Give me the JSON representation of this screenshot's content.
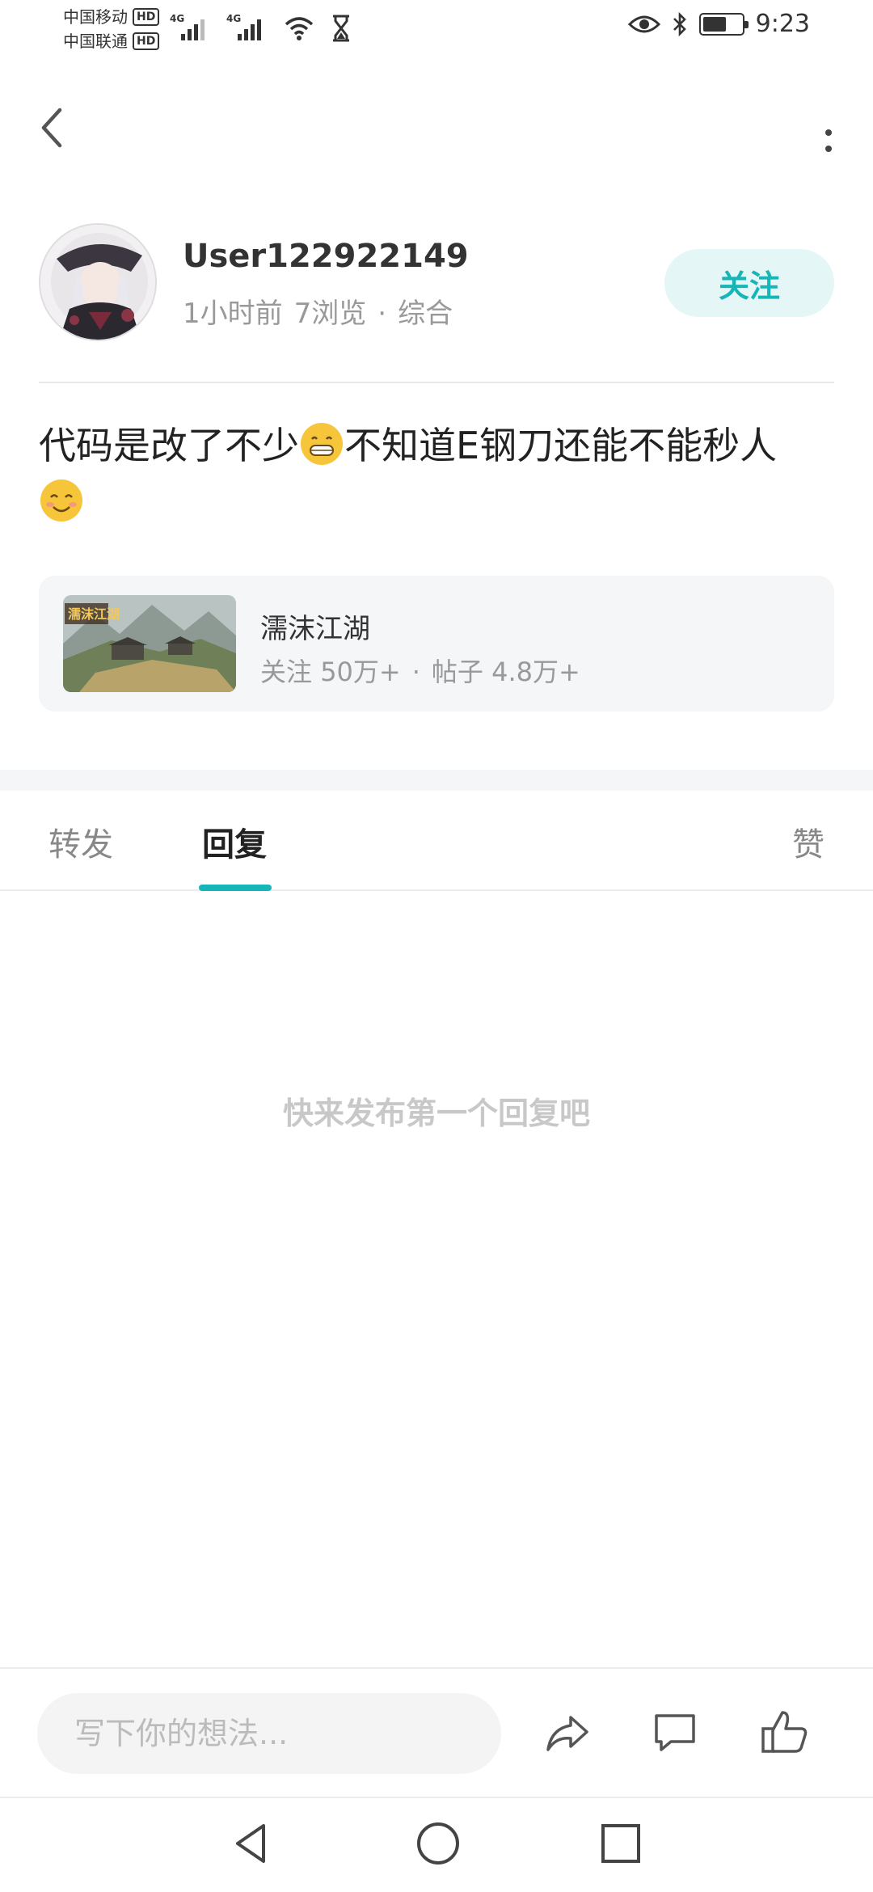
{
  "status_bar": {
    "carrier1": "中国移动",
    "carrier2": "中国联通",
    "hd": "HD",
    "network1": "4G",
    "network2": "4G",
    "time": "9:23",
    "icons": [
      "signal-icon",
      "wifi-icon",
      "hourglass-icon",
      "eye-icon",
      "bluetooth-icon",
      "battery-icon"
    ]
  },
  "nav": {
    "back_icon": "chevron-left-icon",
    "more_icon": "more-vertical-icon"
  },
  "author": {
    "name": "User122922149",
    "time_ago": "1小时前",
    "views": "7浏览",
    "separator": "·",
    "category": "综合",
    "follow_label": "关注"
  },
  "post": {
    "text_part1": "代码是改了不少",
    "text_part2": "不知道E钢刀还能不能秒人",
    "emoji1": "grin-emoji",
    "emoji2": "smile-emoji"
  },
  "forum": {
    "name": "濡沫江湖",
    "thumb_text": "濡沫江湖",
    "followers_label": "关注",
    "followers": "50万+",
    "separator": "·",
    "posts_label": "帖子",
    "posts": "4.8万+"
  },
  "tabs": {
    "repost": "转发",
    "reply": "回复",
    "like": "赞",
    "active": "回复"
  },
  "empty_state": "快来发布第一个回复吧",
  "bottom_bar": {
    "placeholder": "写下你的想法...",
    "share_icon": "share-icon",
    "comment_icon": "comment-icon",
    "like_icon": "thumbs-up-icon"
  },
  "colors": {
    "accent": "#16b5b8",
    "follow_bg": "#e5f6f6",
    "muted": "#999999",
    "card_bg": "#f4f6f8"
  }
}
